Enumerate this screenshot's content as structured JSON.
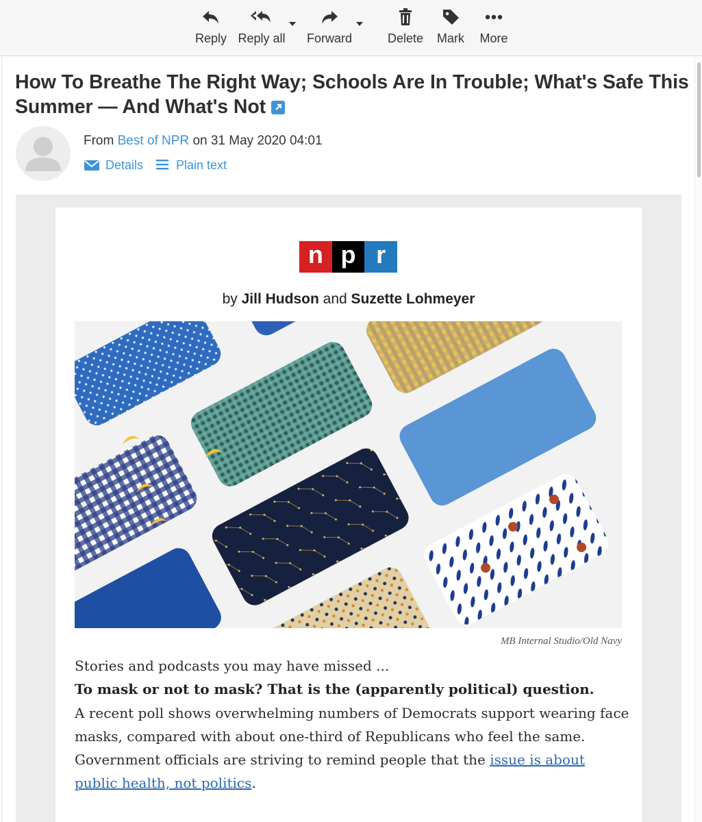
{
  "toolbar": {
    "reply": {
      "label": "Reply",
      "icon": "reply-icon"
    },
    "reply_all": {
      "label": "Reply all",
      "icon": "reply-all-icon"
    },
    "forward": {
      "label": "Forward",
      "icon": "forward-icon"
    },
    "delete": {
      "label": "Delete",
      "icon": "trash-icon"
    },
    "mark": {
      "label": "Mark",
      "icon": "tag-icon"
    },
    "more": {
      "label": "More",
      "icon": "more-dots-icon"
    }
  },
  "message": {
    "subject": "How To Breathe The Right Way; Schools Are In Trouble; What's Safe This Summer — And What's Not",
    "from_prefix": "From",
    "sender": "Best of NPR",
    "date_prefix": "on",
    "date": "31 May 2020 04:01",
    "details_label": "Details",
    "plain_text_label": "Plain text"
  },
  "email": {
    "logo": {
      "letters": [
        "n",
        "p",
        "r"
      ],
      "colors": [
        "#d62021",
        "#000000",
        "#237bbd"
      ]
    },
    "byline_prefix": "by",
    "author1": "Jill Hudson",
    "byline_and": "and",
    "author2": "Suzette Lohmeyer",
    "photo_credit": "MB Internal Studio/Old Navy",
    "intro": "Stories and podcasts you may have missed ...",
    "headline": "To mask or not to mask? That is the (apparently political) question.",
    "paragraph": "A recent poll shows overwhelming numbers of Democrats support wearing face masks, compared with about one-third of Republicans who feel the same. Government officials are striving to remind people that the ",
    "link_text": "issue is about public health, not politics",
    "paragraph_end": "."
  },
  "colors": {
    "accent": "#3f93d6",
    "link": "#2a6ab3"
  }
}
